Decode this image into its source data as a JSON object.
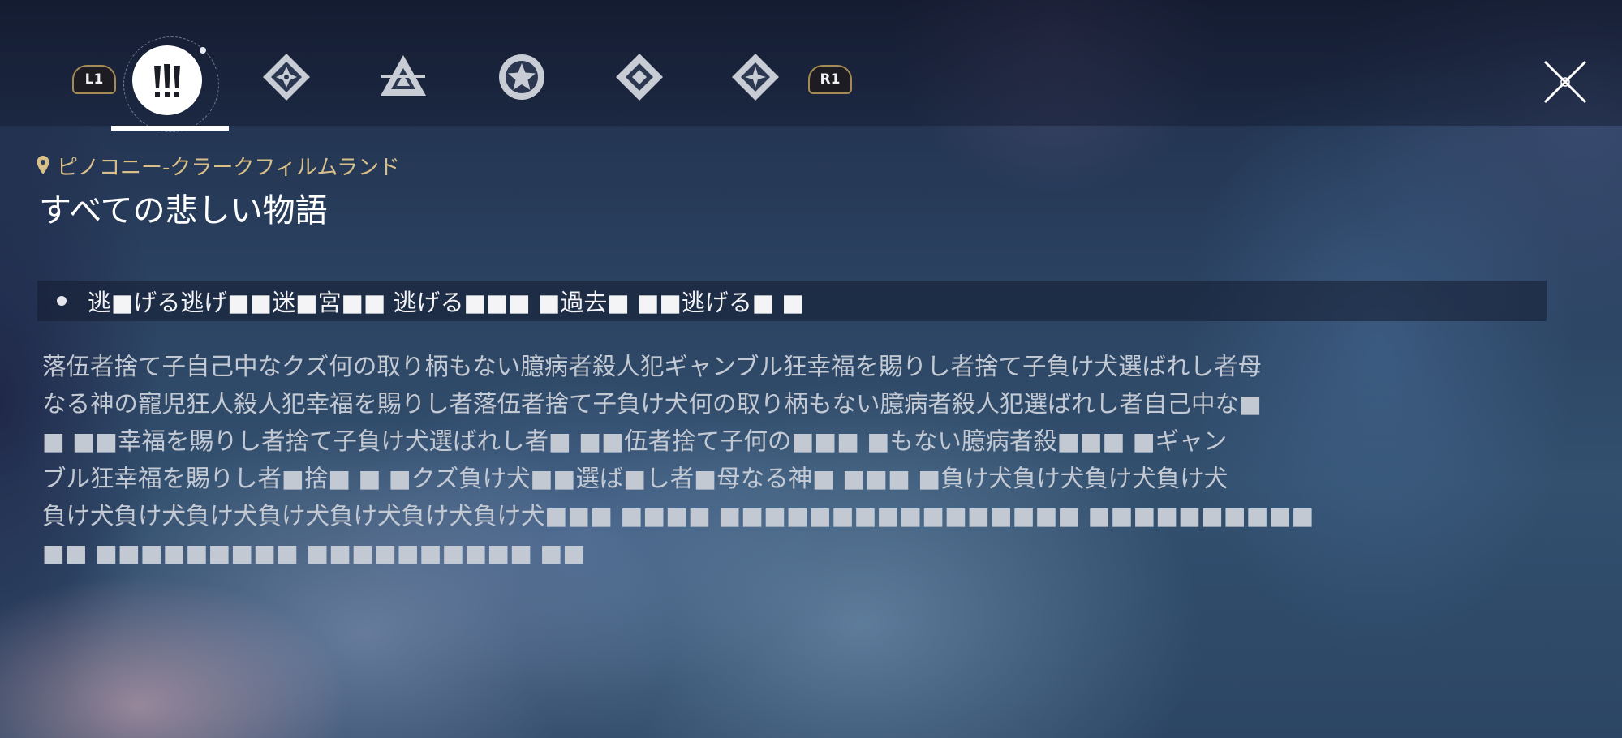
{
  "tabs": {
    "prev_hint": "L1",
    "next_hint": "R1",
    "items": [
      {
        "icon": "exclamation-triple-icon",
        "active": true
      },
      {
        "icon": "diamond-star-icon",
        "active": false
      },
      {
        "icon": "triangle-icon",
        "active": false
      },
      {
        "icon": "star-icon",
        "active": false
      },
      {
        "icon": "diamond-icon",
        "active": false
      },
      {
        "icon": "diamond-sparkle-icon",
        "active": false
      }
    ]
  },
  "quest": {
    "location": "ピノコニー-クラークフィルムランド",
    "title": "すべての悲しい物語",
    "objective": "逃■げる逃げ■■迷■宮■■ 逃げる■■■ ■過去■ ■■逃げる■ ■",
    "description_lines": [
      "落伍者捨て子自己中なクズ何の取り柄もない臆病者殺人犯ギャンブル狂幸福を賜りし者捨て子負け犬選ばれし者母",
      "なる神の寵児狂人殺人犯幸福を賜りし者落伍者捨て子負け犬何の取り柄もない臆病者殺人犯選ばれし者自己中な■",
      "■ ■■幸福を賜りし者捨て子負け犬選ばれし者■ ■■伍者捨て子何の■■■ ■もない臆病者殺■■■ ■ギャン",
      "ブル狂幸福を賜りし者■捨■ ■ ■クズ負け犬■■選ば■し者■母なる神■ ■■■ ■負け犬負け犬負け犬負け犬",
      "負け犬負け犬負け犬負け犬負け犬負け犬負け犬■■■ ■■■■ ■■■■■■■■■■■■■■■■ ■■■■■■■■■■",
      "■■ ■■■■■■■■■ ■■■■■■■■■■ ■■"
    ]
  },
  "colors": {
    "location_text": "#d9c08a",
    "title_text": "#ffffff",
    "description_text": "#c3c9d3",
    "hint_border": "#a58a56"
  }
}
